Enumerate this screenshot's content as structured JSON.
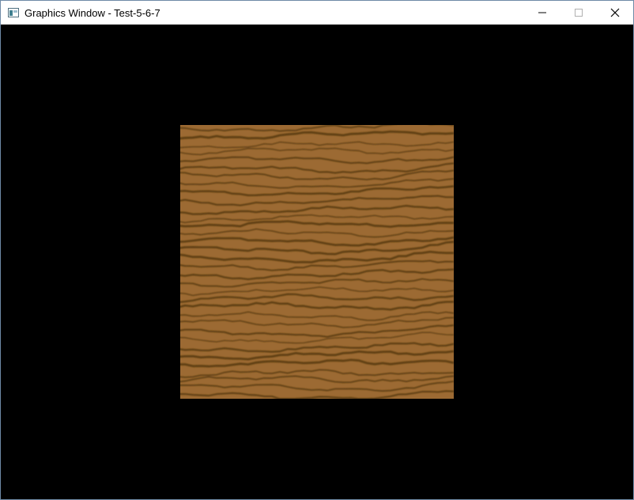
{
  "window": {
    "title": "Graphics Window - Test-5-6-7",
    "icon": "app-window-icon",
    "controls": [
      "minimize-icon",
      "maximize-icon",
      "close-icon"
    ]
  },
  "scene": {
    "background_color": "#000000",
    "texture": "wood-grain",
    "base_color": "#9c6a33",
    "grain_color": "#5a3a10"
  }
}
